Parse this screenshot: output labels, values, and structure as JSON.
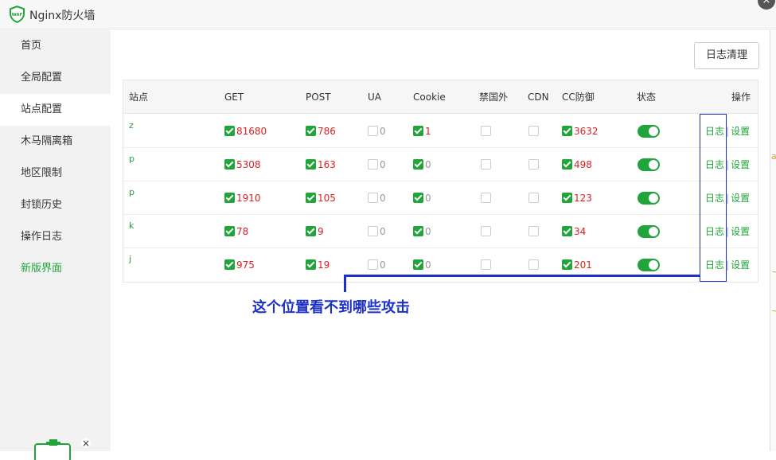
{
  "app": {
    "title": "Nginx防火墙",
    "logo_text": "WAF",
    "close_label": "×"
  },
  "sidebar": {
    "items": [
      {
        "label": "首页"
      },
      {
        "label": "全局配置"
      },
      {
        "label": "站点配置"
      },
      {
        "label": "木马隔离箱"
      },
      {
        "label": "地区限制"
      },
      {
        "label": "封锁历史"
      },
      {
        "label": "操作日志"
      },
      {
        "label": "新版界面"
      }
    ],
    "float_close": "×"
  },
  "toolbar": {
    "clear_log_label": "日志清理"
  },
  "table": {
    "headers": [
      "站点",
      "GET",
      "POST",
      "UA",
      "Cookie",
      "禁国外",
      "CDN",
      "CC防御",
      "状态",
      "操作"
    ],
    "rows": [
      {
        "site": "z",
        "get": "81680",
        "post": "786",
        "ua": "0",
        "cookie": "1",
        "cc": "3632",
        "log": "日志",
        "sep": "|",
        "settings": "设置"
      },
      {
        "site": "p",
        "get": "5308",
        "post": "163",
        "ua": "0",
        "cookie": "0",
        "cc": "498",
        "log": "日志",
        "sep": "|",
        "settings": "设置"
      },
      {
        "site": "p",
        "get": "1910",
        "post": "105",
        "ua": "0",
        "cookie": "0",
        "cc": "123",
        "log": "日志",
        "sep": "|",
        "settings": "设置"
      },
      {
        "site": "k",
        "get": "78",
        "post": "9",
        "ua": "0",
        "cookie": "0",
        "cc": "34",
        "log": "日志",
        "sep": "|",
        "settings": "设置"
      },
      {
        "site": "j",
        "get": "975",
        "post": "19",
        "ua": "0",
        "cookie": "0",
        "cc": "201",
        "log": "日志",
        "sep": "|",
        "settings": "设置"
      }
    ]
  },
  "annotation": {
    "text": "这个位置看不到哪些攻击"
  },
  "colors": {
    "accent": "#20a53a",
    "annotation": "#1c2fc7",
    "count": "#e02020"
  }
}
